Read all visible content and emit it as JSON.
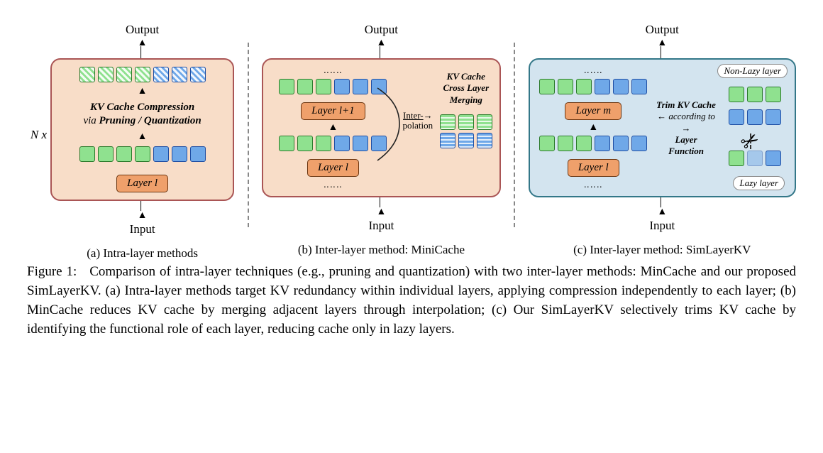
{
  "figure_number": "Figure 1:",
  "nx_label": "N x",
  "io": {
    "output": "Output",
    "input": "Input"
  },
  "panel_a": {
    "label": "(a) Intra-layer methods",
    "text1": "KV Cache Compression",
    "text2_prefix": "via ",
    "text2_bold": "Pruning / Quantization",
    "layer": "Layer l"
  },
  "panel_b": {
    "label": "(b) Inter-layer method: MiniCache",
    "layer_top": "Layer l+1",
    "layer_bot": "Layer l",
    "inter": "Inter-",
    "polation": "polation",
    "merge1": "KV Cache",
    "merge2": "Cross Layer",
    "merge3": "Merging"
  },
  "panel_c": {
    "label": "(c) Inter-layer method: SimLayerKV",
    "layer_top": "Layer m",
    "layer_bot": "Layer l",
    "trim1": "Trim KV Cache",
    "trim2": "according to",
    "trim3": "Layer",
    "trim4": "Function",
    "nonlazy": "Non-Lazy layer",
    "lazy": "Lazy layer"
  },
  "caption": "Comparison of intra-layer techniques (e.g., pruning and quantization) with two inter-layer methods: MinCache and our proposed SimLayerKV. (a) Intra-layer methods target KV redundancy within individual layers, applying compression independently to each layer; (b) MinCache reduces KV cache by merging adjacent layers through interpolation; (c) Our SimLayerKV selectively trims KV cache by identifying the functional role of each layer, reducing cache only in lazy layers."
}
